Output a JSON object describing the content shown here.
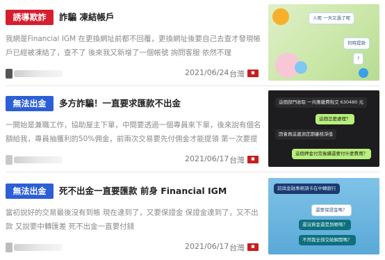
{
  "colors": {
    "badge_red": "#d61e2e",
    "badge_blue": "#2c5fd6"
  },
  "posts": [
    {
      "badge": "誘導欺詐",
      "title": "詐騙 凍結帳戶",
      "excerpt": "我網是Financial IGM 在更換網址前都不回覆，更換網址後要自己去查才發現帳戶已經被凍結了，查不了 後來我又新增了一個帳號 詢問客服 依然不理",
      "date": "2021/06/24",
      "region": "台灣",
      "flag_icon": "taiwan-flag-icon",
      "thumb_text": {
        "a": "人呢 一天又過了呢",
        "b": "何時提款",
        "c": "?"
      }
    },
    {
      "badge": "無法出金",
      "title": "多方詐騙！一直要求匯款不出金",
      "excerpt": "一開始是兼職工作，協助屋主下單，中間要透過一個專員來下單，後來說有個名額給我，專員抽獲利的50%佣金，前兩次交易要先付佣金才能提領 第一次要提領...",
      "date": "2021/06/17",
      "region": "台灣",
      "flag_icon": "taiwan-flag-icon",
      "thumb_text": {
        "a": "這個部門收取 一共應繳費稅交 630480 元",
        "b": "這個怎麼處理？",
        "c": "因會員這邊須定期審核淨值",
        "d": "這個押金付完後續還要付什麼費用？"
      }
    },
    {
      "badge": "無法出金",
      "title": "死不出金一直要匯款 前身 Financial IGM",
      "excerpt": "當初說好的交易最後沒有到帳 現在達到了，又要保證金 保證金達到了，又不出款 又說要中轉匯差 死不出金一直要付錢",
      "date": "2021/06/17",
      "region": "台灣",
      "flag_icon": "taiwan-flag-icon",
      "thumb_text": {
        "a": "前與金融事務調卡在中轉銀行",
        "b": "還要保證金嗎？",
        "c": "還沒資金還是到帳嗎？",
        "d": "不然我全部交給解開嗎？"
      }
    }
  ]
}
